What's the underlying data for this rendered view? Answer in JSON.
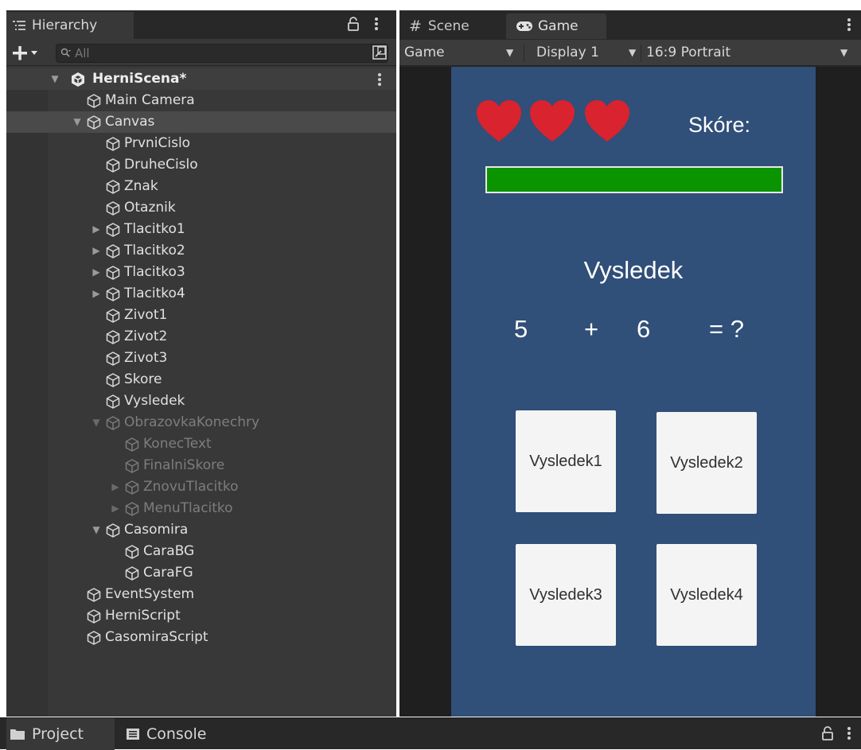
{
  "hierarchy": {
    "tab_label": "Hierarchy",
    "search_placeholder": "All",
    "scene_name": "HerniScena*",
    "items": [
      {
        "label": "Main Camera"
      },
      {
        "label": "Canvas"
      },
      {
        "label": "PrvniCislo"
      },
      {
        "label": "DruheCislo"
      },
      {
        "label": "Znak"
      },
      {
        "label": "Otaznik"
      },
      {
        "label": "Tlacitko1"
      },
      {
        "label": "Tlacitko2"
      },
      {
        "label": "Tlacitko3"
      },
      {
        "label": "Tlacitko4"
      },
      {
        "label": "Zivot1"
      },
      {
        "label": "Zivot2"
      },
      {
        "label": "Zivot3"
      },
      {
        "label": "Skore"
      },
      {
        "label": "Vysledek"
      },
      {
        "label": "ObrazovkaKonechry"
      },
      {
        "label": "KonecText"
      },
      {
        "label": "FinalniSkore"
      },
      {
        "label": "ZnovuTlacitko"
      },
      {
        "label": "MenuTlacitko"
      },
      {
        "label": "Casomira"
      },
      {
        "label": "CaraBG"
      },
      {
        "label": "CaraFG"
      },
      {
        "label": "EventSystem"
      },
      {
        "label": "HerniScript"
      },
      {
        "label": "CasomiraScript"
      }
    ]
  },
  "game_view": {
    "tabs": {
      "scene": "Scene",
      "game": "Game"
    },
    "toolbar": {
      "mode": "Game",
      "display": "Display 1",
      "aspect": "16:9 Portrait"
    },
    "screen": {
      "lives": 3,
      "score_label": "Skóre:",
      "timer_fill_fraction": 1.0,
      "result_title": "Vysledek",
      "equation": {
        "first": "5",
        "operator": "+",
        "second": "6",
        "equals": "= ?"
      },
      "answers": [
        "Vysledek1",
        "Vysledek2",
        "Vysledek3",
        "Vysledek4"
      ]
    },
    "colors": {
      "screen_bg": "#304f79",
      "timer_fill": "#0a9400",
      "heart": "#d9232e"
    }
  },
  "bottom_panel": {
    "tabs": {
      "project": "Project",
      "console": "Console"
    }
  }
}
